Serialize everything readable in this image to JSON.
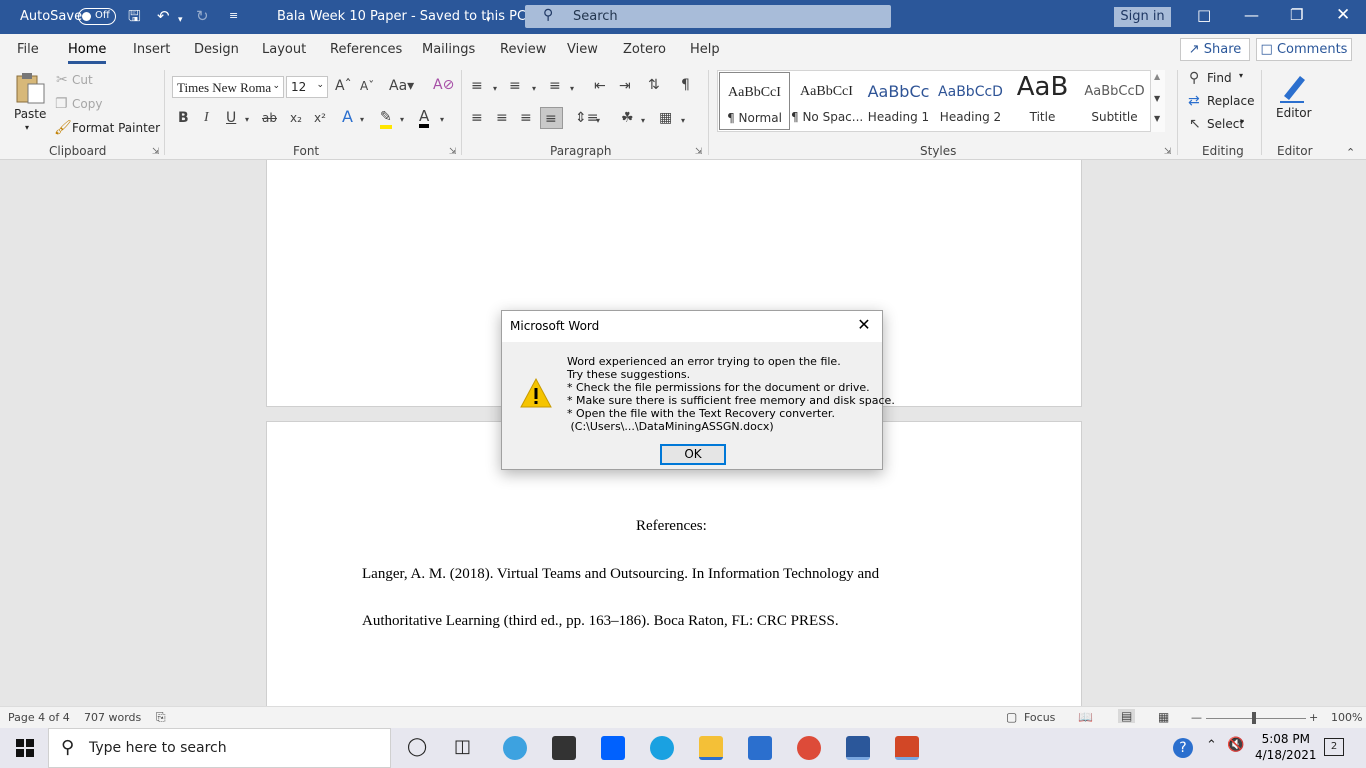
{
  "titlebar": {
    "autosave": "AutoSave",
    "toggle": "Off",
    "doc_title": "Bala Week 10 Paper  -  Saved to this PC",
    "search_placeholder": "Search",
    "signin": "Sign in"
  },
  "menu": {
    "tabs": [
      "File",
      "Home",
      "Insert",
      "Design",
      "Layout",
      "References",
      "Mailings",
      "Review",
      "View",
      "Zotero",
      "Help"
    ],
    "share": "Share",
    "comments": "Comments"
  },
  "ribbon": {
    "clipboard": {
      "paste": "Paste",
      "cut": "Cut",
      "copy": "Copy",
      "format_painter": "Format Painter",
      "label": "Clipboard"
    },
    "font": {
      "name": "Times New Roma",
      "size": "12",
      "label": "Font"
    },
    "paragraph": {
      "label": "Paragraph"
    },
    "styles": {
      "label": "Styles",
      "items": [
        {
          "preview": "AaBbCcI",
          "name": "¶ Normal"
        },
        {
          "preview": "AaBbCcI",
          "name": "¶ No Spac..."
        },
        {
          "preview": "AaBbCc",
          "name": "Heading 1"
        },
        {
          "preview": "AaBbCcD",
          "name": "Heading 2"
        },
        {
          "preview": "AaB",
          "name": "Title"
        },
        {
          "preview": "AaBbCcD",
          "name": "Subtitle"
        }
      ]
    },
    "editing": {
      "find": "Find",
      "replace": "Replace",
      "select": "Select",
      "label": "Editing"
    },
    "editor": {
      "name": "Editor",
      "label": "Editor"
    }
  },
  "document": {
    "heading": "References:",
    "line1": "Langer, A. M. (2018). Virtual Teams and Outsourcing. In Information Technology and",
    "line2": "Authoritative Learning (third ed., pp. 163–186). Boca Raton, FL: CRC PRESS."
  },
  "dialog": {
    "title": "Microsoft Word",
    "message": "Word experienced an error trying to open the file.\nTry these suggestions.\n* Check the file permissions for the document or drive.\n* Make sure there is sufficient free memory and disk space.\n* Open the file with the Text Recovery converter.\n (C:\\Users\\...\\DataMiningASSGN.docx)",
    "ok": "OK"
  },
  "statusbar": {
    "page": "Page 4 of 4",
    "words": "707 words",
    "focus": "Focus",
    "zoom": "100%"
  },
  "taskbar": {
    "search_placeholder": "Type here to search",
    "time": "5:08 PM",
    "date": "4/18/2021",
    "notifications": "2"
  },
  "colors": {
    "word_blue": "#2b579a",
    "dialog_ok_border": "#0078d7",
    "warning": "#f5c400"
  }
}
